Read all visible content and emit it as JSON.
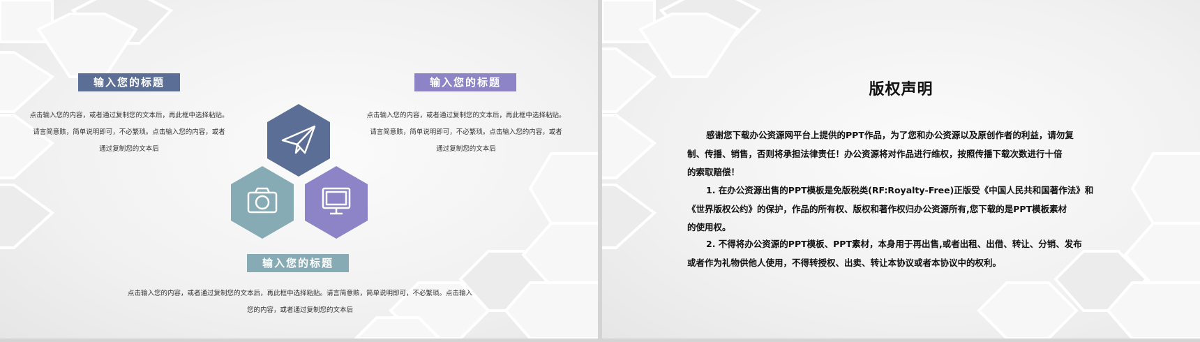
{
  "left_slide": {
    "block1": {
      "title": "输入您的标题",
      "line1": "点击输入您的内容，或者通过复制您的文本后，再此框中选择粘贴。",
      "line2": "请言简意赅，简单说明即可，不必繁琐。点击输入您的内容，或者",
      "line3": "通过复制您的文本后",
      "color": "#5b6e96"
    },
    "block2": {
      "title": "输入您的标题",
      "line1": "点击输入您的内容，或者通过复制您的文本后，再此框中选择粘贴。",
      "line2": "请言简意赅，简单说明即可，不必繁琐。点击输入您的内容，或者",
      "line3": "通过复制您的文本后",
      "color": "#8d84c8"
    },
    "block3": {
      "title": "输入您的标题",
      "line1": "点击输入您的内容，或者通过复制您的文本后，再此框中选择粘贴。请言简意赅，简单说明即可，不必繁琐。点击输入",
      "line2": "您的内容，或者通过复制您的文本后",
      "color": "#86abb5"
    },
    "hex_icons": [
      {
        "icon": "paper-plane-icon",
        "color": "#5b6e96"
      },
      {
        "icon": "camera-icon",
        "color": "#86abb5"
      },
      {
        "icon": "monitor-icon",
        "color": "#8d84c8"
      }
    ]
  },
  "right_slide": {
    "title": "版权声明",
    "paragraphs": [
      {
        "l1": "感谢您下载办公资源网平台上提供的PPT作品，为了您和办公资源以及原创作者的利益，请勿复",
        "l2": "制、传播、销售，否则将承担法律责任！办公资源将对作品进行维权，按照传播下载次数进行十倍",
        "l3": "的索取赔偿！"
      },
      {
        "l1": "1. 在办公资源出售的PPT模板是免版税类(RF:Royalty-Free)正版受《中国人民共和国著作法》和",
        "l2": "《世界版权公约》的保护，作品的所有权、版权和著作权归办公资源所有,您下载的是PPT模板素材",
        "l3": "的使用权。"
      },
      {
        "l1": "2. 不得将办公资源的PPT模板、PPT素材，本身用于再出售,或者出租、出借、转让、分销、发布",
        "l2": "或者作为礼物供他人使用，不得转授权、出卖、转让本协议或者本协议中的权利。"
      }
    ]
  }
}
